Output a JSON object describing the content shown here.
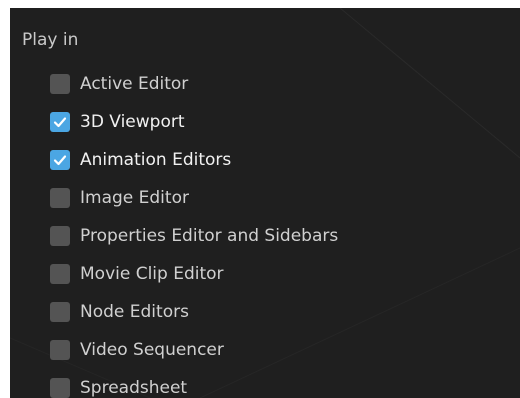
{
  "section": {
    "title": "Play in"
  },
  "options": [
    {
      "label": "Active Editor",
      "checked": false
    },
    {
      "label": "3D Viewport",
      "checked": true
    },
    {
      "label": "Animation Editors",
      "checked": true
    },
    {
      "label": "Image Editor",
      "checked": false
    },
    {
      "label": "Properties Editor and Sidebars",
      "checked": false
    },
    {
      "label": "Movie Clip Editor",
      "checked": false
    },
    {
      "label": "Node Editors",
      "checked": false
    },
    {
      "label": "Video Sequencer",
      "checked": false
    },
    {
      "label": "Spreadsheet",
      "checked": false
    }
  ],
  "colors": {
    "panel_background": "#1f1f1f",
    "checkbox_unchecked": "#545454",
    "checkbox_checked": "#4ba6e3",
    "checkmark": "#ffffff",
    "text": "#d0d0d0"
  },
  "icons": {
    "checkmark": "checkmark-icon"
  }
}
